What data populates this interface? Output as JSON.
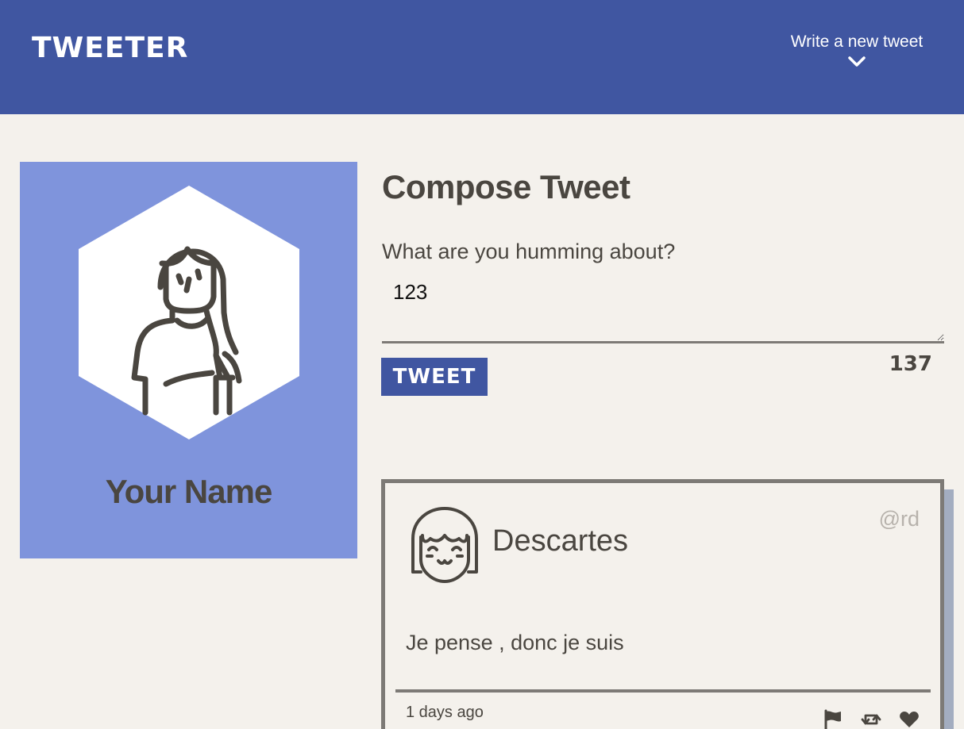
{
  "header": {
    "brand": "TWEETER",
    "write_toggle_label": "Write a new tweet",
    "toggle_icon": "chevron-down-icon"
  },
  "profile": {
    "name": "Your Name",
    "avatar_icon": "woman-avatar-icon",
    "background_color": "#7f94dc"
  },
  "composer": {
    "title": "Compose Tweet",
    "label": "What are you humming about?",
    "text_value": "123",
    "submit_label": "TWEET",
    "char_counter": "137"
  },
  "tweets": [
    {
      "author_name": "Descartes",
      "handle": "@rd",
      "avatar_icon": "girl-avatar-icon",
      "content": "Je pense , donc je suis",
      "timestamp": "1 days ago",
      "actions": [
        {
          "name": "flag",
          "icon": "flag-icon"
        },
        {
          "name": "retweet",
          "icon": "retweet-icon"
        },
        {
          "name": "like",
          "icon": "heart-icon"
        }
      ]
    }
  ],
  "colors": {
    "nav_background": "#4056a1",
    "page_background": "#f4f1ec",
    "text": "#4a4640",
    "muted_handle": "#b7b2ac",
    "tweet_shadow": "#a3adc0"
  }
}
